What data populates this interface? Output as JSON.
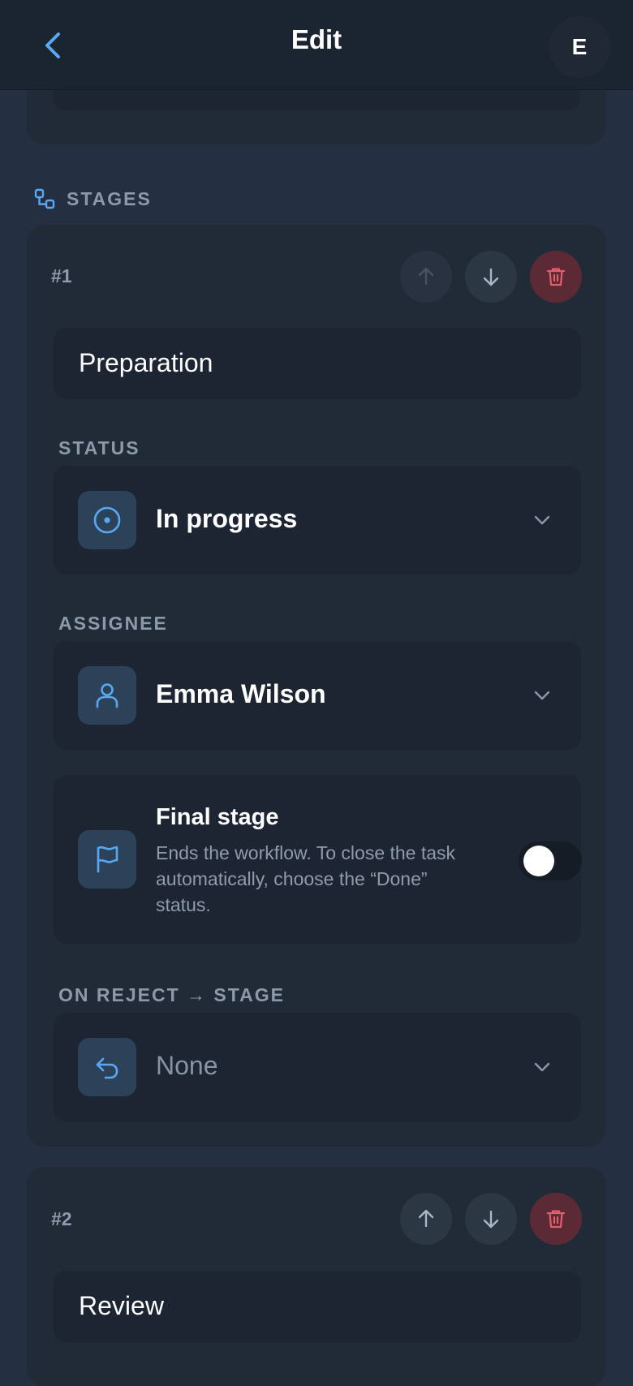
{
  "header": {
    "title": "Edit",
    "avatar_initial": "E"
  },
  "stages_section": {
    "label": "STAGES"
  },
  "stages": [
    {
      "number": "#1",
      "name": "Preparation",
      "status": {
        "label": "STATUS",
        "value": "In progress"
      },
      "assignee": {
        "label": "ASSIGNEE",
        "value": "Emma Wilson"
      },
      "final_stage": {
        "title": "Final stage",
        "description": "Ends the workflow. To close the task automatically, choose the “Done” status.",
        "enabled": false
      },
      "on_reject": {
        "label": "ON REJECT → STAGE",
        "value": "None"
      }
    },
    {
      "number": "#2",
      "name": "Review"
    }
  ],
  "colors": {
    "background": "#243041",
    "card": "#212b38",
    "field": "#1c2531",
    "accent_blue": "#5aa7f2",
    "danger": "#e0606d"
  },
  "icons": [
    "chevron-left-icon",
    "stages-icon",
    "arrow-up-icon",
    "arrow-down-icon",
    "trash-icon",
    "target-icon",
    "user-icon",
    "flag-icon",
    "undo-icon",
    "chevron-down-icon"
  ]
}
